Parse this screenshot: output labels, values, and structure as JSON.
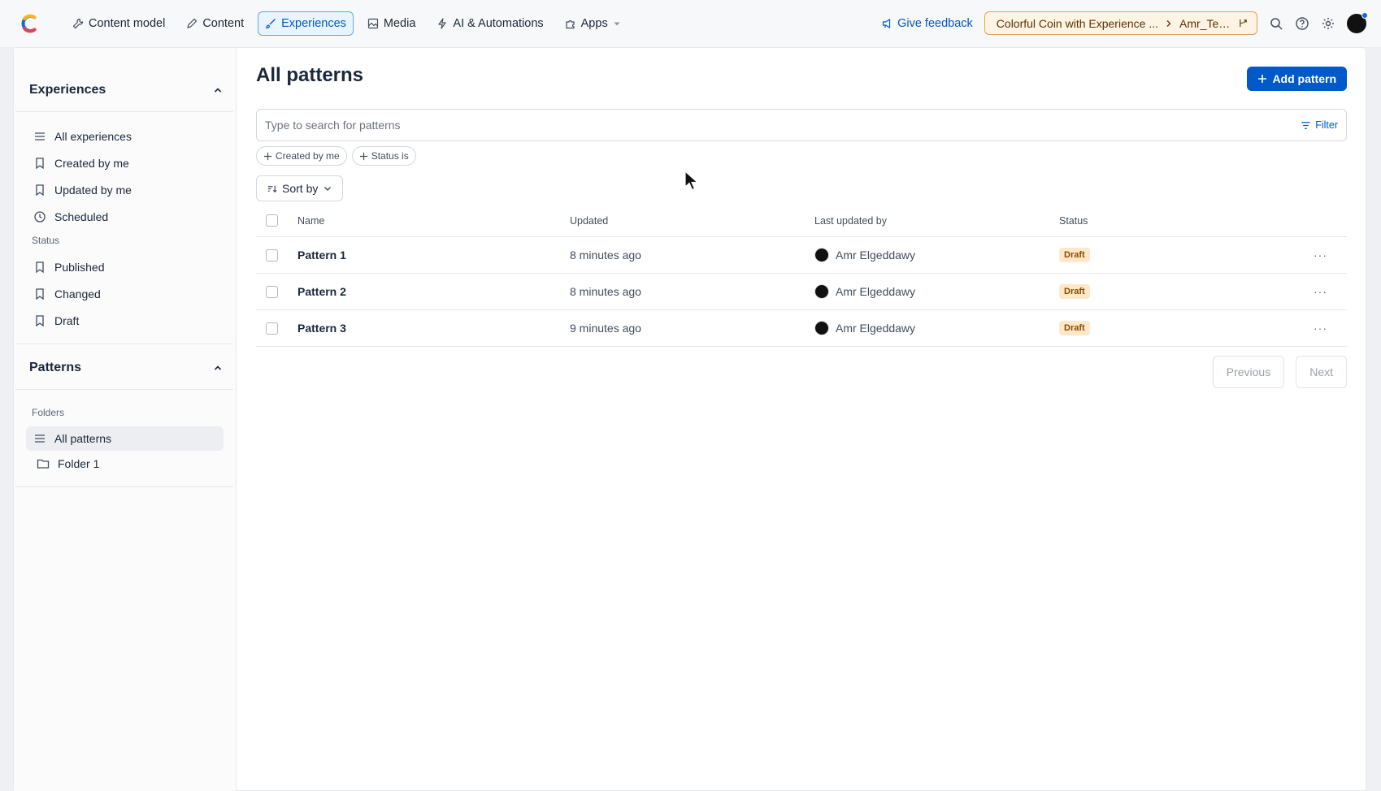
{
  "nav": {
    "items": [
      {
        "label": "Content model",
        "icon": "wrench-icon"
      },
      {
        "label": "Content",
        "icon": "pen-icon"
      },
      {
        "label": "Experiences",
        "icon": "brush-icon",
        "active": true
      },
      {
        "label": "Media",
        "icon": "image-icon"
      },
      {
        "label": "AI & Automations",
        "icon": "bolt-icon"
      },
      {
        "label": "Apps",
        "icon": "puzzle-icon"
      }
    ],
    "feedback_label": "Give feedback",
    "env": {
      "space": "Colorful Coin with Experience ...",
      "environment": "Amr_Tes..."
    }
  },
  "sidebar": {
    "experiences": {
      "title": "Experiences",
      "items": [
        {
          "label": "All experiences",
          "icon": "list-icon"
        },
        {
          "label": "Created by me",
          "icon": "bookmark-icon"
        },
        {
          "label": "Updated by me",
          "icon": "bookmark-icon"
        },
        {
          "label": "Scheduled",
          "icon": "clock-icon"
        }
      ],
      "status_label": "Status",
      "status_items": [
        {
          "label": "Published",
          "icon": "bookmark-icon"
        },
        {
          "label": "Changed",
          "icon": "bookmark-icon"
        },
        {
          "label": "Draft",
          "icon": "bookmark-icon"
        }
      ]
    },
    "patterns": {
      "title": "Patterns",
      "folders_label": "Folders",
      "items": [
        {
          "label": "All patterns",
          "icon": "list-icon",
          "selected": true
        },
        {
          "label": "Folder 1",
          "icon": "folder-icon"
        }
      ]
    }
  },
  "main": {
    "title": "All patterns",
    "add_button": "Add pattern",
    "search_placeholder": "Type to search for patterns",
    "filter_label": "Filter",
    "chips": [
      "Created by me",
      "Status is"
    ],
    "sort_label": "Sort by",
    "columns": [
      "Name",
      "Updated",
      "Last updated by",
      "Status"
    ],
    "rows": [
      {
        "name": "Pattern 1",
        "updated": "8 minutes ago",
        "by": "Amr Elgeddawy",
        "status": "Draft"
      },
      {
        "name": "Pattern 2",
        "updated": "8 minutes ago",
        "by": "Amr Elgeddawy",
        "status": "Draft"
      },
      {
        "name": "Pattern 3",
        "updated": "9 minutes ago",
        "by": "Amr Elgeddawy",
        "status": "Draft"
      }
    ],
    "more_label": "···",
    "pagination": {
      "previous": "Previous",
      "next": "Next"
    }
  },
  "colors": {
    "accent": "#0059c8",
    "draft_badge_bg": "#ffe7c9",
    "env_border": "#e0a253"
  }
}
